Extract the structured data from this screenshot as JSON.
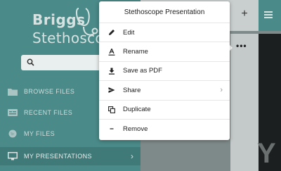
{
  "brand": {
    "line1": "Briggs",
    "line2": "Stethoscope"
  },
  "search": {
    "placeholder": ""
  },
  "nav": {
    "items": [
      {
        "label": "BROWSE FILES",
        "icon": "folder-icon"
      },
      {
        "label": "RECENT FILES",
        "icon": "recent-files-icon"
      },
      {
        "label": "MY FILES",
        "icon": "globe-icon"
      },
      {
        "label": "MY PRESENTATIONS",
        "icon": "monitor-icon",
        "active": true
      }
    ]
  },
  "toolbar": {
    "add_label": "+",
    "more_label": "•••"
  },
  "background_letter": "Y",
  "menu": {
    "title": "Stethoscope Presentation",
    "items": [
      {
        "label": "Edit",
        "icon": "pencil-icon"
      },
      {
        "label": "Rename",
        "icon": "rename-icon"
      },
      {
        "label": "Save as PDF",
        "icon": "download-icon"
      },
      {
        "label": "Share",
        "icon": "send-icon",
        "has_submenu": true
      },
      {
        "label": "Duplicate",
        "icon": "duplicate-icon"
      },
      {
        "label": "Remove",
        "icon": "minus-icon"
      }
    ]
  },
  "colors": {
    "sidebar": "#4a8a88",
    "sidebar_active": "#3f7a78",
    "menu_bg": "#ffffff"
  }
}
